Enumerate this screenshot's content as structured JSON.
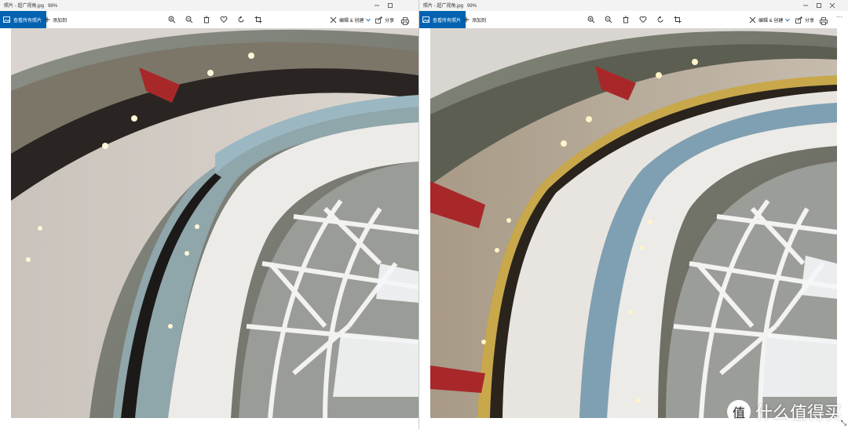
{
  "colors": {
    "accent": "#0063b1",
    "titlebar": "#f3f3f3"
  },
  "windows": [
    {
      "id": "left",
      "title": "照片 - 超广视角.jpg",
      "zoom": "98%",
      "view_all_label": "查看所有照片",
      "add_to_label": "添加到",
      "edit_label": "编辑 & 创建",
      "share_label": "分享",
      "icons": [
        "zoom-in-icon",
        "zoom-out-icon",
        "delete-icon",
        "heart-icon",
        "rotate-icon",
        "crop-icon",
        "print-icon"
      ]
    },
    {
      "id": "right",
      "title": "照片 - 超广视角.jpg",
      "zoom": "99%",
      "view_all_label": "查看所有照片",
      "add_to_label": "添加到",
      "edit_label": "编辑 & 创建",
      "share_label": "分享",
      "more_label": "···",
      "icons": [
        "zoom-in-icon",
        "zoom-out-icon",
        "delete-icon",
        "heart-icon",
        "rotate-icon",
        "crop-icon",
        "print-icon",
        "more-icon"
      ]
    }
  ],
  "watermark": {
    "text": "什么值得买",
    "badge": "值"
  }
}
